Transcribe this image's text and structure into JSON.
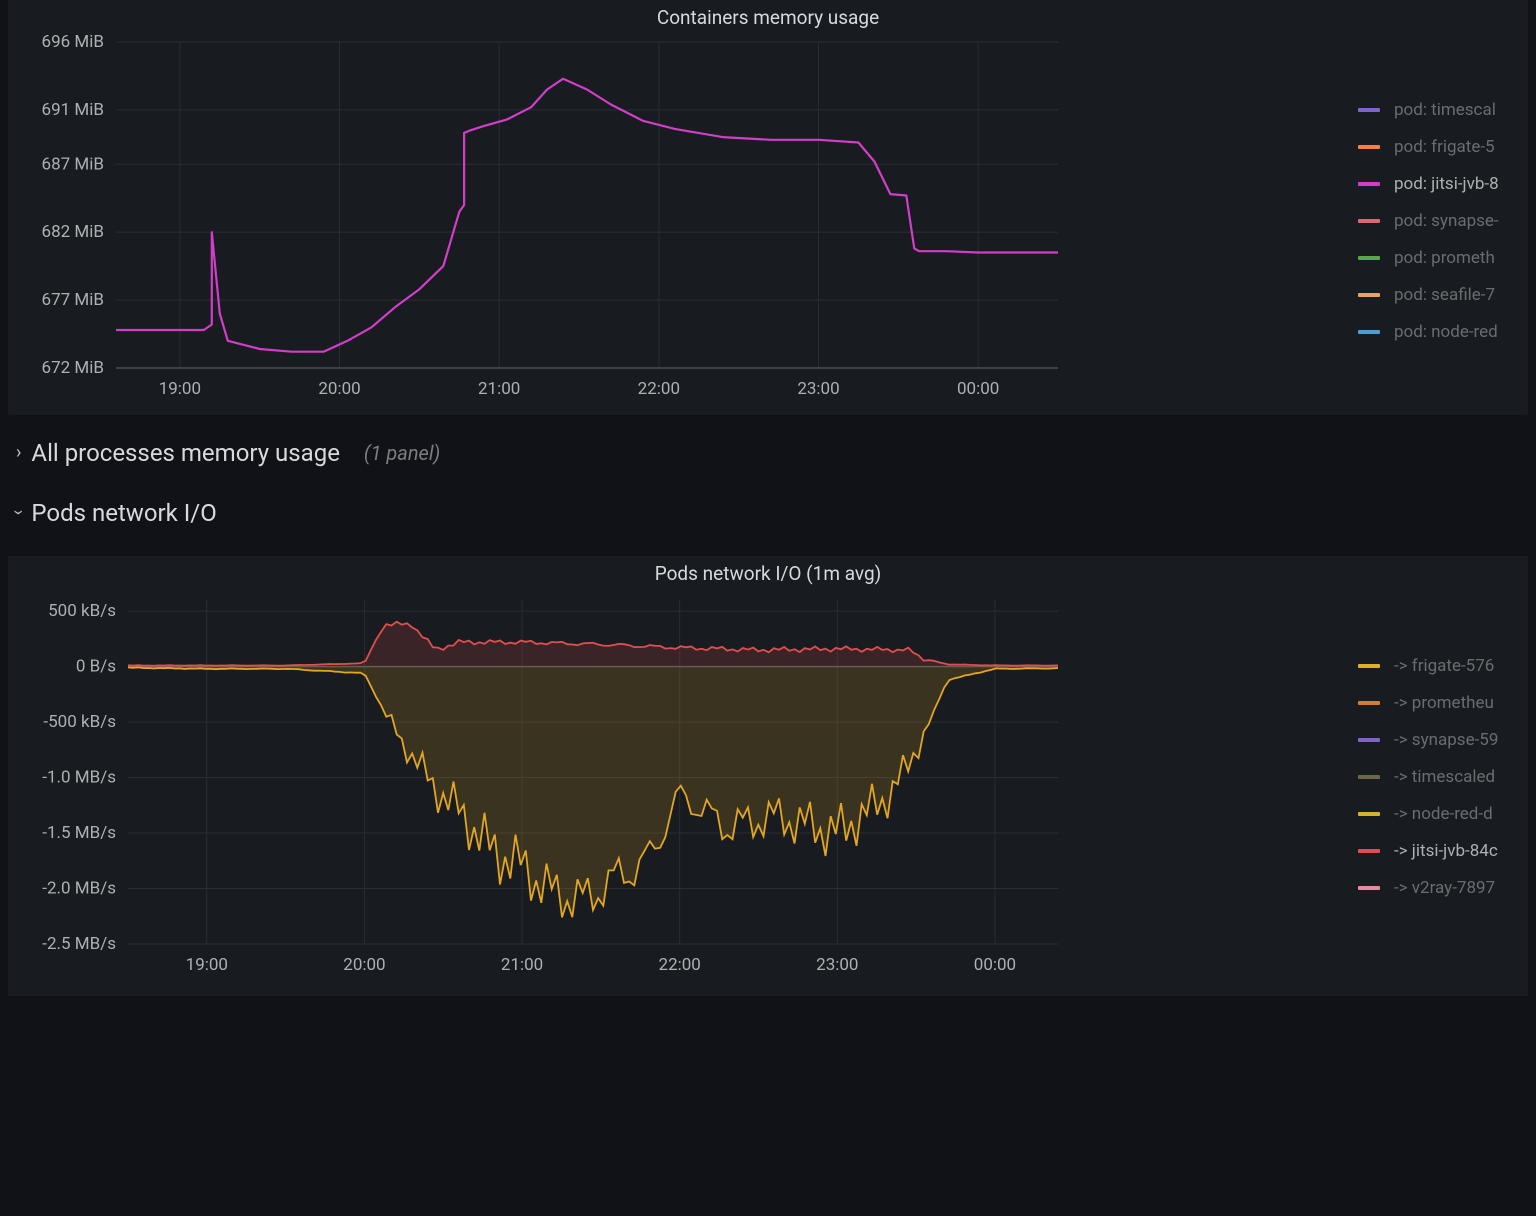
{
  "panel1": {
    "title": "Containers memory usage",
    "legend": [
      {
        "label": "pod: timescal",
        "color": "#7f65c9",
        "dim": true
      },
      {
        "label": "pod: frigate-5",
        "color": "#f2823c",
        "dim": true
      },
      {
        "label": "pod: jitsi-jvb-8",
        "color": "#d23ec9",
        "dim": false
      },
      {
        "label": "pod: synapse-",
        "color": "#e2646d",
        "dim": true
      },
      {
        "label": "pod: prometh",
        "color": "#5aa64b",
        "dim": true
      },
      {
        "label": "pod: seafile-7",
        "color": "#e8a35e",
        "dim": true
      },
      {
        "label": "pod: node-red",
        "color": "#4a9ed8",
        "dim": true
      }
    ],
    "yticks": [
      "696 MiB",
      "691 MiB",
      "687 MiB",
      "682 MiB",
      "677 MiB",
      "672 MiB"
    ],
    "xticks": [
      "19:00",
      "20:00",
      "21:00",
      "22:00",
      "23:00",
      "00:00"
    ]
  },
  "row_collapsed": {
    "title": "All processes memory usage",
    "sub": "(1 panel)"
  },
  "row_expanded": {
    "title": "Pods network I/O"
  },
  "panel2": {
    "title": "Pods network I/O (1m avg)",
    "legend": [
      {
        "label": "-> frigate-576",
        "color": "#d9b12d",
        "dim": true
      },
      {
        "label": "-> prometheu",
        "color": "#d97b2d",
        "dim": true
      },
      {
        "label": "-> synapse-59",
        "color": "#7f65c9",
        "dim": true
      },
      {
        "label": "-> timescaled",
        "color": "#6f6649",
        "dim": true
      },
      {
        "label": "-> node-red-d",
        "color": "#d9b12d",
        "dim": true
      },
      {
        "label": "-> jitsi-jvb-84c",
        "color": "#e04f4f",
        "dim": false
      },
      {
        "label": "-> v2ray-7897",
        "color": "#e88aa0",
        "dim": true
      }
    ],
    "yticks": [
      "500 kB/s",
      "0 B/s",
      "-500 kB/s",
      "-1.0 MB/s",
      "-1.5 MB/s",
      "-2.0 MB/s",
      "-2.5 MB/s"
    ],
    "xticks": [
      "19:00",
      "20:00",
      "21:00",
      "22:00",
      "23:00",
      "00:00"
    ]
  },
  "chart_data": [
    {
      "type": "line",
      "title": "Containers memory usage",
      "xlabel": "",
      "ylabel": "",
      "x_range_hours": [
        18.6,
        24.5
      ],
      "ylim": [
        672,
        696
      ],
      "x_ticks": [
        "19:00",
        "20:00",
        "21:00",
        "22:00",
        "23:00",
        "00:00"
      ],
      "y_ticks_MiB": [
        672,
        677,
        682,
        687,
        691,
        696
      ],
      "highlighted_series": "pod: jitsi-jvb-8",
      "series": [
        {
          "name": "pod: jitsi-jvb-8",
          "color": "#d23ec9",
          "x_hours": [
            18.6,
            19.15,
            19.2,
            19.2,
            19.25,
            19.3,
            19.5,
            19.7,
            19.9,
            20.05,
            20.2,
            20.35,
            20.5,
            20.65,
            20.75,
            20.78,
            20.78,
            20.82,
            20.9,
            21.05,
            21.2,
            21.3,
            21.4,
            21.55,
            21.7,
            21.9,
            22.1,
            22.4,
            22.7,
            23.0,
            23.25,
            23.35,
            23.45,
            23.55,
            23.6,
            23.63,
            23.8,
            24.0,
            24.5
          ],
          "y_MiB": [
            674.8,
            674.8,
            675.2,
            682.0,
            676.0,
            674.0,
            673.4,
            673.2,
            673.2,
            674.0,
            675.0,
            676.5,
            677.8,
            679.5,
            683.5,
            684.0,
            689.3,
            689.5,
            689.8,
            690.3,
            691.2,
            692.5,
            693.3,
            692.5,
            691.4,
            690.2,
            689.6,
            689.0,
            688.8,
            688.8,
            688.6,
            687.2,
            684.8,
            684.7,
            680.8,
            680.6,
            680.6,
            680.5,
            680.5
          ]
        }
      ],
      "legend_entries": [
        "pod: timescal",
        "pod: frigate-5",
        "pod: jitsi-jvb-8",
        "pod: synapse-",
        "pod: prometh",
        "pod: seafile-7",
        "pod: node-red"
      ]
    },
    {
      "type": "line",
      "title": "Pods network I/O (1m avg)",
      "xlabel": "",
      "ylabel": "",
      "x_range_hours": [
        18.5,
        24.4
      ],
      "ylim_MBps": [
        -2.5,
        0.6
      ],
      "x_ticks": [
        "19:00",
        "20:00",
        "21:00",
        "22:00",
        "23:00",
        "00:00"
      ],
      "y_ticks": [
        "500 kB/s",
        "0 B/s",
        "-500 kB/s",
        "-1.0 MB/s",
        "-1.5 MB/s",
        "-2.0 MB/s",
        "-2.5 MB/s"
      ],
      "series": [
        {
          "name": "-> jitsi-jvb-84c (rx, positive)",
          "color": "#e04f4f",
          "x_hours": [
            18.5,
            19.0,
            19.5,
            20.0,
            20.12,
            20.3,
            20.45,
            20.6,
            21.0,
            21.5,
            22.0,
            22.5,
            23.0,
            23.45,
            23.55,
            23.7,
            24.0,
            24.4
          ],
          "y_kBps": [
            10,
            10,
            10,
            30,
            380,
            380,
            150,
            220,
            220,
            200,
            170,
            150,
            160,
            150,
            70,
            20,
            10,
            10
          ]
        },
        {
          "name": "-> jitsi-jvb-84c (tx, negative)",
          "color": "#e2a622",
          "fill": true,
          "x_hours": [
            18.5,
            19.0,
            19.5,
            20.0,
            20.12,
            20.25,
            20.45,
            20.6,
            20.8,
            21.0,
            21.2,
            21.4,
            21.6,
            21.8,
            22.0,
            22.3,
            22.6,
            23.0,
            23.3,
            23.45,
            23.55,
            23.7,
            24.0,
            24.4
          ],
          "y_kBps": [
            -10,
            -20,
            -20,
            -60,
            -400,
            -700,
            -1100,
            -1300,
            -1650,
            -1800,
            -2050,
            -2100,
            -1900,
            -1750,
            -1150,
            -1450,
            -1350,
            -1500,
            -1200,
            -900,
            -600,
            -120,
            -20,
            -15
          ]
        }
      ],
      "legend_entries": [
        "-> frigate-576",
        "-> prometheu",
        "-> synapse-59",
        "-> timescaled",
        "-> node-red-d",
        "-> jitsi-jvb-84c",
        "-> v2ray-7897"
      ]
    }
  ]
}
